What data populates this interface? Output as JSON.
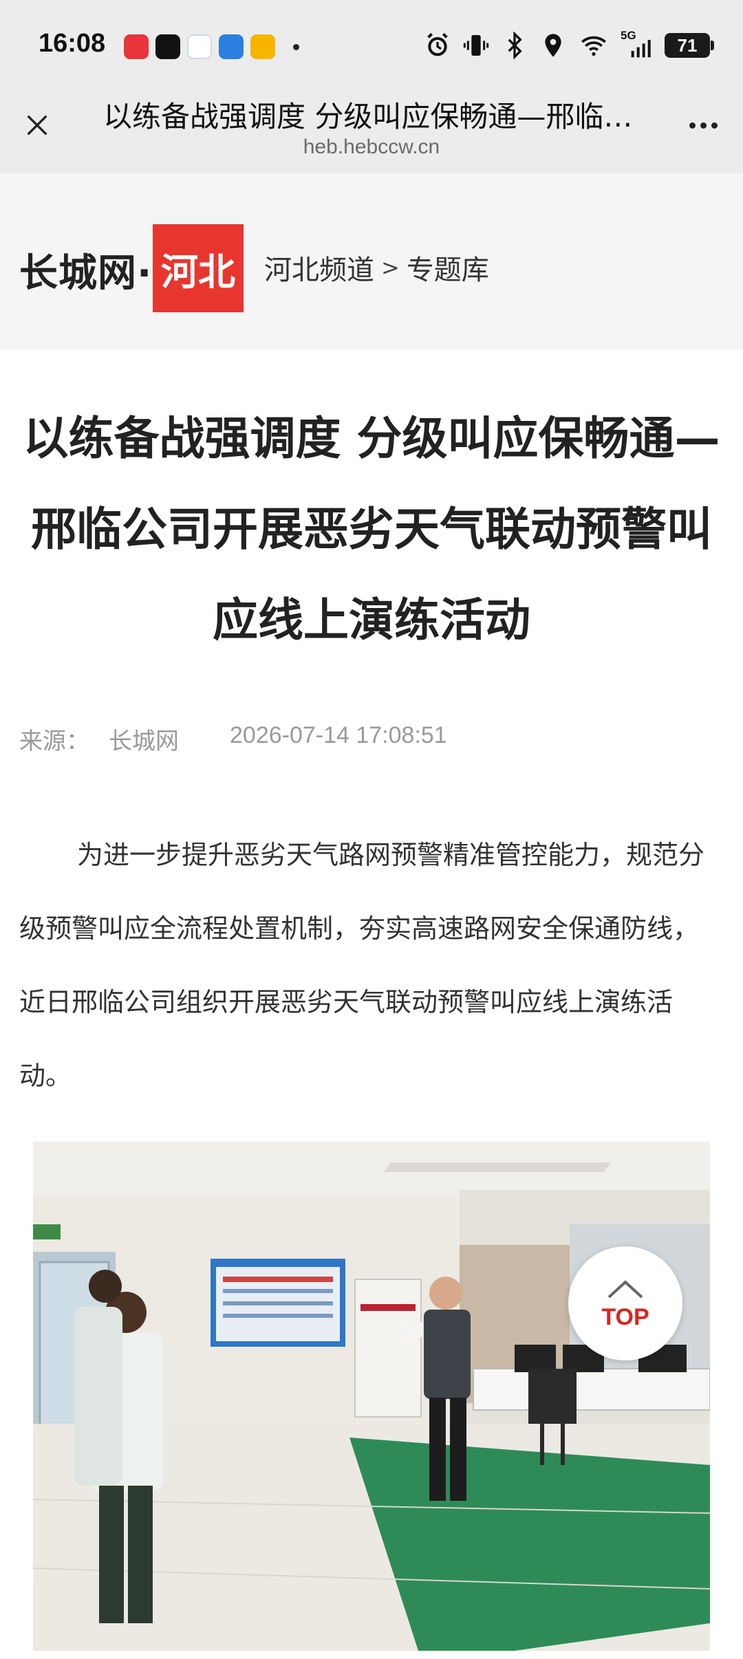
{
  "status_bar": {
    "time": "16:08",
    "battery": "71",
    "network": "5G"
  },
  "browser": {
    "title": "以练备战强调度 分级叫应保畅通—邢临公司开展恶劣天气联动预警叫应线上演练活动",
    "url": "heb.hebccw.cn",
    "close_icon": "close-icon",
    "more_icon": "more-icon"
  },
  "site": {
    "logo_text": "长城网·",
    "logo_badge": "河北",
    "breadcrumb": [
      "河北频道",
      ">",
      "专题库"
    ]
  },
  "article": {
    "title": "以练备战强调度 分级叫应保畅通—邢临公司开展恶劣天气联动预警叫应线上演练活动",
    "source_label": "来源：",
    "source_name": "长城网",
    "date": "2026-07-14 17:08:51",
    "paragraph": "为进一步提升恶劣天气路网预警精准管控能力，规范分级预警叫应全流程处置机制，夯实高速路网安全保通防线，近日邢临公司组织开展恶劣天气联动预警叫应线上演练活动。"
  },
  "top_button": {
    "label": "TOP"
  },
  "colors": {
    "brand_red": "#e8362f",
    "top_red": "#d9251c",
    "header_bg": "#ececec"
  }
}
